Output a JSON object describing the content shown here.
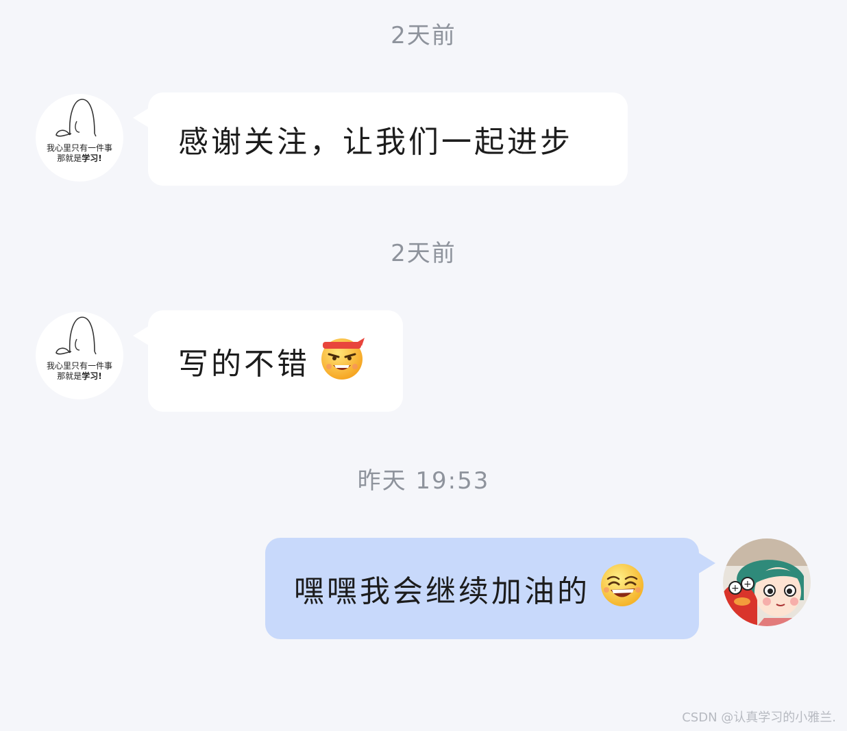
{
  "messages": [
    {
      "timestamp": "2天前",
      "side": "incoming",
      "avatar_caption_line1": "我心里只有一件事",
      "avatar_caption_line2_prefix": "那就是",
      "avatar_caption_line2_bold": "学习!",
      "text": "感谢关注，让我们一起进步",
      "emoji": ""
    },
    {
      "timestamp": "2天前",
      "side": "incoming",
      "avatar_caption_line1": "我心里只有一件事",
      "avatar_caption_line2_prefix": "那就是",
      "avatar_caption_line2_bold": "学习!",
      "text": "写的不错",
      "emoji": "determined-headband-emoji"
    },
    {
      "timestamp": "昨天 19:53",
      "side": "outgoing",
      "text": "嘿嘿我会继续加油的",
      "emoji": "grinning-squint-emoji"
    }
  ],
  "watermark": "CSDN @认真学习的小雅兰.",
  "colors": {
    "background": "#f5f6fa",
    "incoming_bubble": "#ffffff",
    "outgoing_bubble": "#c8d9fb",
    "timestamp_text": "#8e939c"
  }
}
